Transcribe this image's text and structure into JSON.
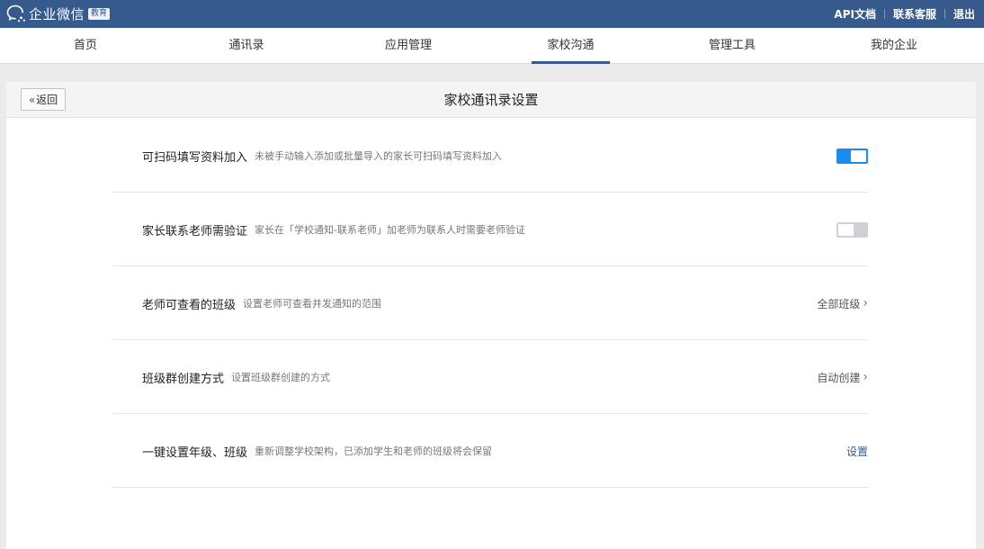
{
  "header": {
    "logo_text": "企业微信",
    "logo_badge": "教育",
    "links": [
      {
        "label": "API文档"
      },
      {
        "label": "联系客服"
      },
      {
        "label": "退出"
      }
    ]
  },
  "nav": {
    "tabs": [
      {
        "label": "首页"
      },
      {
        "label": "通讯录"
      },
      {
        "label": "应用管理"
      },
      {
        "label": "家校沟通",
        "active": true
      },
      {
        "label": "管理工具"
      },
      {
        "label": "我的企业"
      }
    ]
  },
  "panel": {
    "back_label": "返回",
    "title": "家校通讯录设置",
    "rows": [
      {
        "title": "可扫码填写资料加入",
        "desc": "未被手动输入添加或批量导入的家长可扫码填写资料加入",
        "control": "toggle",
        "enabled": true
      },
      {
        "title": "家长联系老师需验证",
        "desc": "家长在「学校通知-联系老师」加老师为联系人时需要老师验证",
        "control": "toggle",
        "enabled": false
      },
      {
        "title": "老师可查看的班级",
        "desc": "设置老师可查看并发通知的范围",
        "control": "value",
        "value": "全部班级"
      },
      {
        "title": "班级群创建方式",
        "desc": "设置班级群创建的方式",
        "control": "value",
        "value": "自动创建"
      },
      {
        "title": "一键设置年级、班级",
        "desc": "重新调整学校架构，已添加学生和老师的班级将会保留",
        "control": "action",
        "value": "设置"
      }
    ]
  },
  "colors": {
    "header_bg": "#365a8c",
    "toggle_on": "#1a8cf0",
    "toggle_off": "#cfd1d4"
  }
}
